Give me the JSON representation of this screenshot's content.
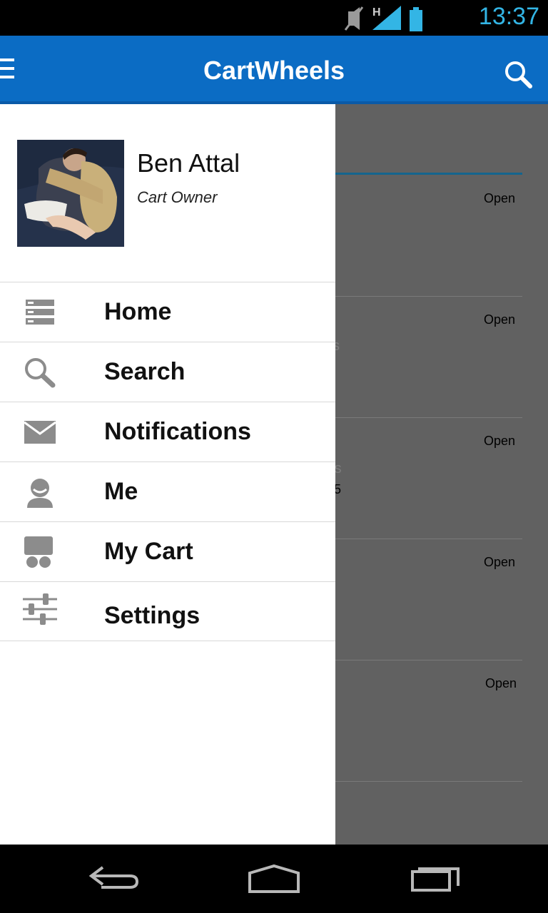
{
  "status_bar": {
    "time": "13:37",
    "network": "H"
  },
  "app_bar": {
    "title": "CartWheels"
  },
  "user": {
    "name": "Ben Attal",
    "role": "Cart Owner"
  },
  "menu": [
    {
      "label": "Home",
      "icon": "home-list-icon"
    },
    {
      "label": "Search",
      "icon": "search-icon"
    },
    {
      "label": "Notifications",
      "icon": "envelope-icon"
    },
    {
      "label": "Me",
      "icon": "person-icon"
    },
    {
      "label": "My Cart",
      "icon": "cart-icon"
    },
    {
      "label": "Settings",
      "icon": "sliders-icon"
    }
  ],
  "background_list": {
    "status_labels": [
      "Open",
      "Open",
      "Open",
      "Open",
      "Open"
    ],
    "partial_texts": [
      "s",
      "rs",
      "5"
    ]
  },
  "colors": {
    "app_bar": "#0b6cc4",
    "status_time": "#33b5e5",
    "scrim": "#616161"
  }
}
